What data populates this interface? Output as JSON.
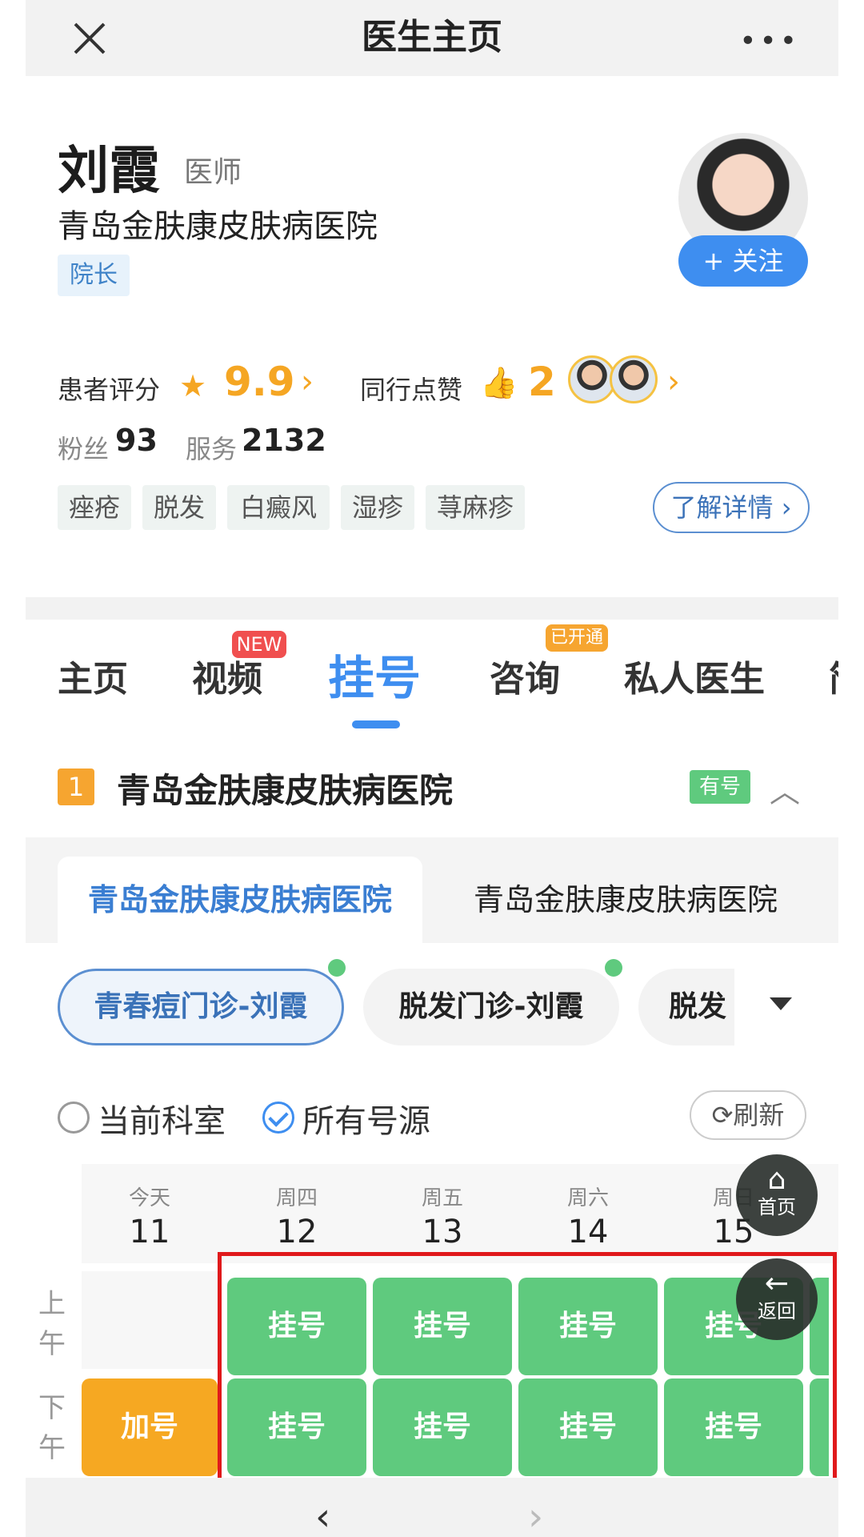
{
  "nav": {
    "title": "医生主页",
    "more": "•••"
  },
  "doctor": {
    "name": "刘霞",
    "role": "医师",
    "hospital": "青岛金肤康皮肤病医院",
    "position_tag": "院长",
    "follow_label": "+ 关注"
  },
  "stats": {
    "score_label": "患者评分",
    "score": "9.9",
    "peer_label": "同行点赞",
    "peer_count": "2",
    "fans_label": "粉丝",
    "fans": "93",
    "service_label": "服务",
    "service": "2132"
  },
  "specialties": [
    "痤疮",
    "脱发",
    "白癜风",
    "湿疹",
    "荨麻疹"
  ],
  "detail_label": "了解详情",
  "tabs": [
    {
      "label": "主页"
    },
    {
      "label": "视频",
      "badge": "NEW"
    },
    {
      "label": "挂号",
      "active": true
    },
    {
      "label": "咨询",
      "badge": "已开通"
    },
    {
      "label": "私人医生"
    },
    {
      "label": "简"
    }
  ],
  "section": {
    "number": "1",
    "title": "青岛金肤康皮肤病医院",
    "status": "有号"
  },
  "hospital_tabs": [
    "青岛金肤康皮肤病医院",
    "青岛金肤康皮肤病医院"
  ],
  "departments": [
    "青春痘门诊-刘霞",
    "脱发门诊-刘霞",
    "脱发"
  ],
  "filter": {
    "current_dept": "当前科室",
    "all_sources": "所有号源",
    "refresh": "刷新"
  },
  "schedule": {
    "days": [
      {
        "weekday": "今天",
        "date": "11"
      },
      {
        "weekday": "周四",
        "date": "12"
      },
      {
        "weekday": "周五",
        "date": "13"
      },
      {
        "weekday": "周六",
        "date": "14"
      },
      {
        "weekday": "周日",
        "date": "15"
      }
    ],
    "am_label": "上午",
    "pm_label": "下午",
    "register_label": "挂号",
    "extra_label": "加号"
  },
  "floating": {
    "home": "首页",
    "back": "返回"
  },
  "colors": {
    "accent": "#3e8ef0",
    "available": "#5fca7e",
    "extra": "#f6a822",
    "highlight": "#e0191b",
    "rating": "#f5a623"
  }
}
